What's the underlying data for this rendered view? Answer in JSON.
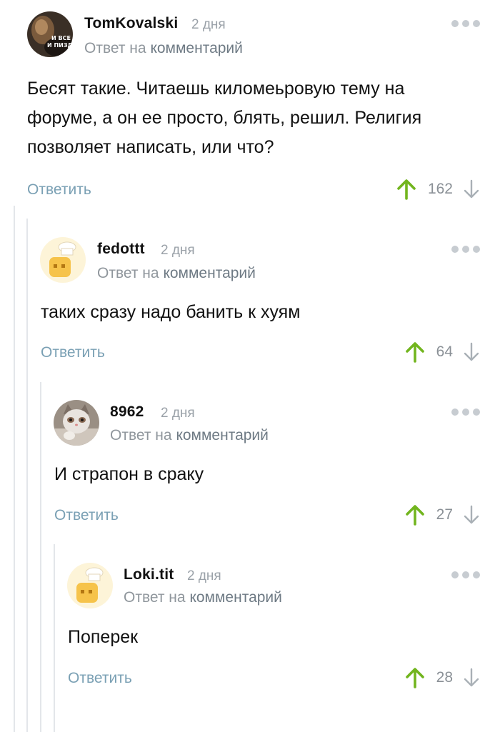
{
  "comments": [
    {
      "author": "TomKovalski",
      "date": "2 дня",
      "reply_prefix": "Ответ на",
      "reply_link": "комментарий",
      "text": "Бесят такие. Читаешь киломеьровую тему на форуме, а он ее просто, блять, решил. Религия позволяет написать, или что?",
      "reply_button": "Ответить",
      "score": "162",
      "avatar": {
        "icon": "dark-meme-avatar",
        "text": "И ВСЕ И ПИЗДЕЦ"
      }
    },
    {
      "author": "fedottt",
      "date": "2 дня",
      "reply_prefix": "Ответ на",
      "reply_link": "комментарий",
      "text": "таких сразу надо банить к хуям",
      "reply_button": "Ответить",
      "score": "64",
      "avatar": {
        "icon": "default-toast-avatar"
      }
    },
    {
      "author": "8962",
      "date": "2 дня",
      "reply_prefix": "Ответ на",
      "reply_link": "комментарий",
      "text": "И страпон в сраку",
      "reply_button": "Ответить",
      "score": "27",
      "avatar": {
        "icon": "kitten-photo-avatar"
      }
    },
    {
      "author": "Loki.tit",
      "date": "2 дня",
      "reply_prefix": "Ответ на",
      "reply_link": "комментарий",
      "text": "Поперек",
      "reply_button": "Ответить",
      "score": "28",
      "avatar": {
        "icon": "default-toast-avatar"
      }
    }
  ],
  "colors": {
    "upvote": "#72b51e",
    "downvote": "#a9b0b6",
    "thread_line": "#e3e6ea",
    "link": "#7aa0b4"
  }
}
